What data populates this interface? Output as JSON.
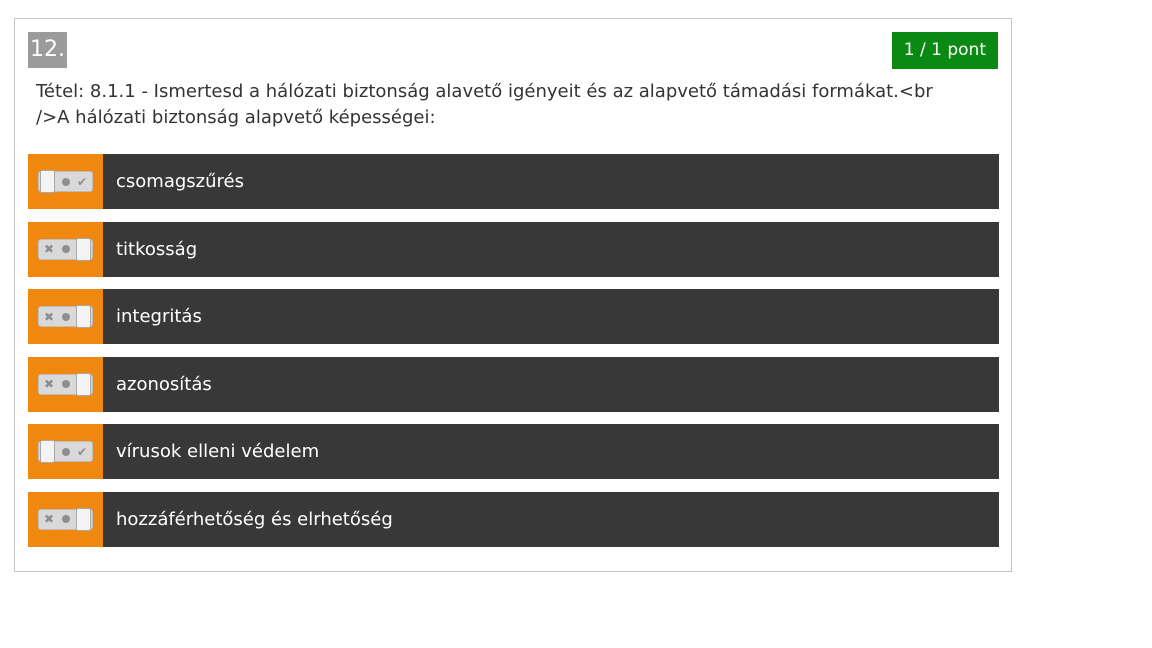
{
  "question": {
    "number": "12.",
    "score": "1 / 1 pont",
    "text": "Tétel: 8.1.1 - Ismertesd a hálózati biztonság alavető igényeit és az alapvető támadási formákat.<br />A hálózati biztonság alapvető képességei:"
  },
  "toggle_icons": {
    "left": "x-icon",
    "middle": "dot-icon",
    "right": "check-icon"
  },
  "colors": {
    "toggle_background": "#f0870e",
    "option_background": "#383838",
    "score_badge": "#0a8a12"
  },
  "options": [
    {
      "label": "csomagszűrés",
      "state": "x"
    },
    {
      "label": "titkosság",
      "state": "check"
    },
    {
      "label": "integritás",
      "state": "check"
    },
    {
      "label": "azonosítás",
      "state": "check"
    },
    {
      "label": "vírusok elleni védelem",
      "state": "x"
    },
    {
      "label": "hozzáférhetőség és elrhetőség",
      "state": "check"
    }
  ]
}
